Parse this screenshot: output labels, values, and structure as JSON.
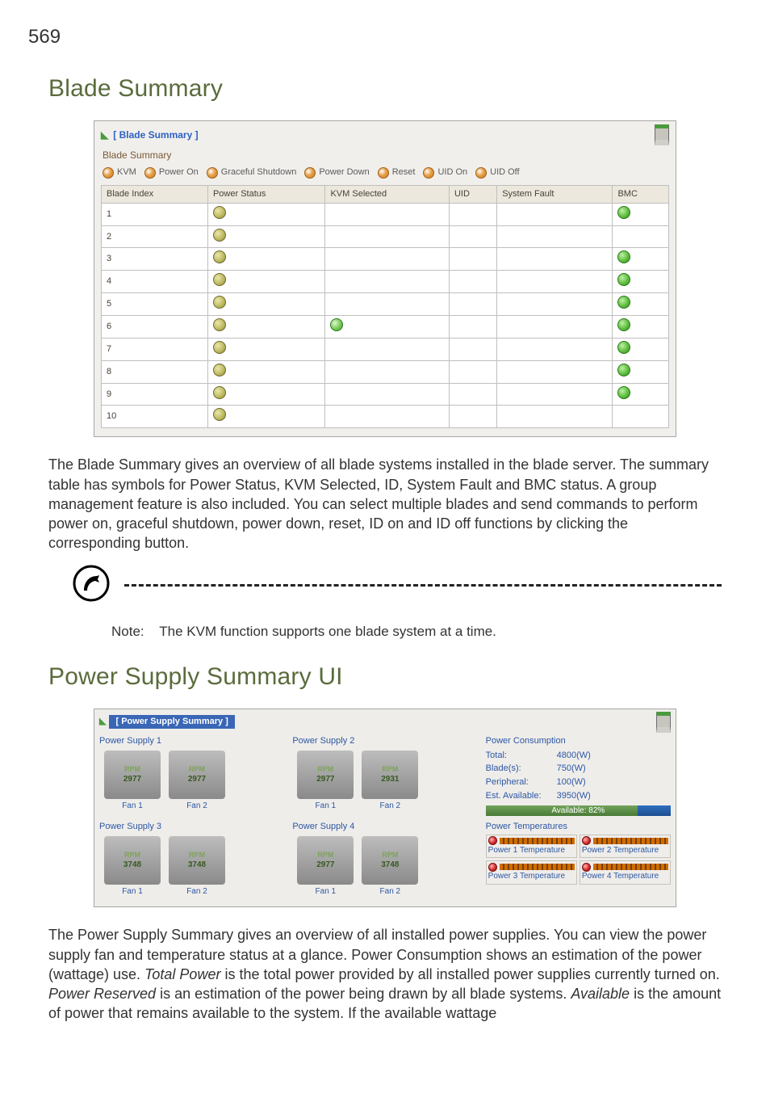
{
  "page_number": "569",
  "section1_title": "Blade Summary",
  "blade_summary_shot": {
    "title": "[ Blade Summary ]",
    "subtitle": "Blade Summary",
    "legend": [
      "KVM",
      "Power On",
      "Graceful Shutdown",
      "Power Down",
      "Reset",
      "UID On",
      "UID Off"
    ],
    "headers": [
      "Blade Index",
      "Power Status",
      "KVM Selected",
      "UID",
      "System Fault",
      "BMC"
    ],
    "rows": [
      {
        "idx": "1",
        "ps": true,
        "kvm": false,
        "bmc": true
      },
      {
        "idx": "2",
        "ps": true,
        "kvm": false,
        "bmc": false
      },
      {
        "idx": "3",
        "ps": true,
        "kvm": false,
        "bmc": true
      },
      {
        "idx": "4",
        "ps": true,
        "kvm": false,
        "bmc": true
      },
      {
        "idx": "5",
        "ps": true,
        "kvm": false,
        "bmc": true
      },
      {
        "idx": "6",
        "ps": true,
        "kvm": true,
        "bmc": true
      },
      {
        "idx": "7",
        "ps": true,
        "kvm": false,
        "bmc": true
      },
      {
        "idx": "8",
        "ps": true,
        "kvm": false,
        "bmc": true
      },
      {
        "idx": "9",
        "ps": true,
        "kvm": false,
        "bmc": true
      },
      {
        "idx": "10",
        "ps": true,
        "kvm": false,
        "bmc": false
      }
    ]
  },
  "para1": "The Blade Summary gives an overview of all blade systems installed in the blade server. The summary table has symbols for Power Status, KVM Selected, ID, System Fault and BMC status. A group management feature is also included. You can select multiple blades and send commands to perform power on, graceful shutdown, power down, reset, ID on and ID off functions by clicking the corresponding button.",
  "note_label": "Note:",
  "note_text": "The KVM function supports one blade system at a time.",
  "section2_title": "Power Supply Summary UI",
  "psu_shot": {
    "title": "[ Power Supply Summary ]",
    "ps1": {
      "label": "Power Supply 1",
      "fan1_rpm": "2977",
      "fan2_rpm": "2977",
      "fan1": "Fan 1",
      "fan2": "Fan 2"
    },
    "ps2": {
      "label": "Power Supply 2",
      "fan1_rpm": "2977",
      "fan2_rpm": "2931",
      "fan1": "Fan 1",
      "fan2": "Fan 2"
    },
    "ps3": {
      "label": "Power Supply 3",
      "fan1_rpm": "3748",
      "fan2_rpm": "3748",
      "fan1": "Fan 1",
      "fan2": "Fan 2"
    },
    "ps4": {
      "label": "Power Supply 4",
      "fan1_rpm": "2977",
      "fan2_rpm": "3748",
      "fan1": "Fan 1",
      "fan2": "Fan 2"
    },
    "consumption": {
      "title": "Power Consumption",
      "total_k": "Total:",
      "total_v": "4800(W)",
      "blade_k": "Blade(s):",
      "blade_v": "750(W)",
      "periph_k": "Peripheral:",
      "periph_v": "100(W)",
      "avail_k": "Est. Available:",
      "avail_v": "3950(W)",
      "meter_text": "Available: 82%"
    },
    "temps": {
      "title": "Power Temperatures",
      "p1": "Power 1 Temperature",
      "p2": "Power 2 Temperature",
      "p3": "Power 3 Temperature",
      "p4": "Power 4 Temperature"
    },
    "rpm_label": "RPM"
  },
  "para2_pre": "The Power Supply Summary gives an overview of all installed power supplies. You can view the power supply fan and temperature status at a glance. Power Consumption shows an estimation of the power (wattage) use. ",
  "para2_total_power": "Total Power",
  "para2_mid1": " is the total power provided by all installed power supplies currently turned on. ",
  "para2_power_reserved": "Power Reserved",
  "para2_mid2": " is an estimation of the power being drawn by all blade systems.  ",
  "para2_available": "Available",
  "para2_end": " is the amount of power that remains available to the system. If the available wattage"
}
